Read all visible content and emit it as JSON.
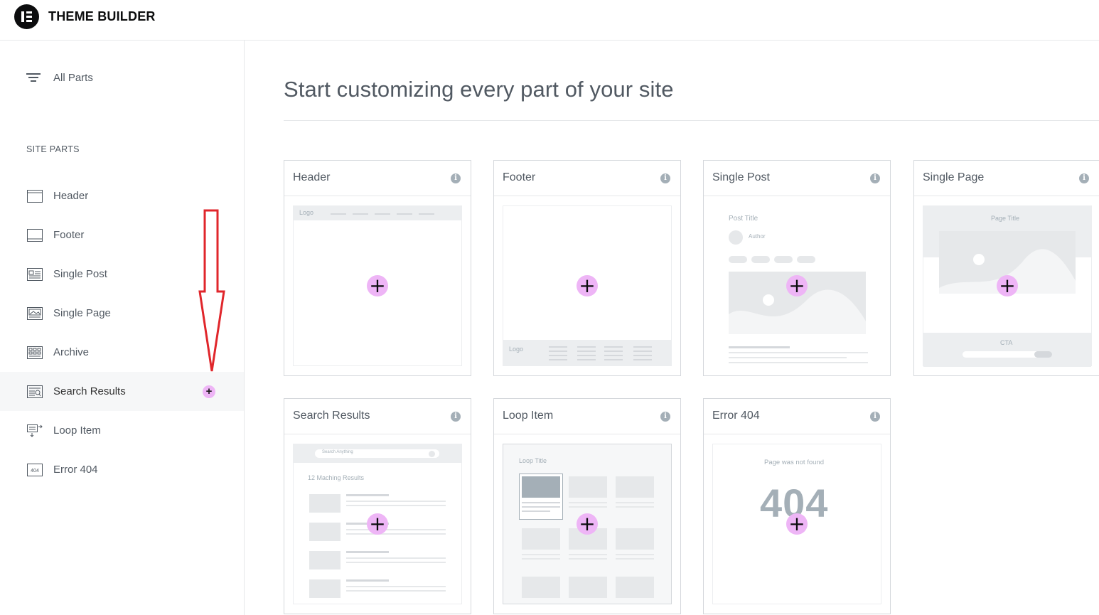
{
  "app": {
    "title": "THEME BUILDER"
  },
  "sidebar": {
    "all_parts_label": "All Parts",
    "section_label": "SITE PARTS",
    "items": [
      {
        "label": "Header",
        "icon": "header-icon"
      },
      {
        "label": "Footer",
        "icon": "footer-icon"
      },
      {
        "label": "Single Post",
        "icon": "single-post-icon"
      },
      {
        "label": "Single Page",
        "icon": "single-page-icon"
      },
      {
        "label": "Archive",
        "icon": "archive-icon"
      },
      {
        "label": "Search Results",
        "icon": "search-results-icon",
        "active": true,
        "add_symbol": "+"
      },
      {
        "label": "Loop Item",
        "icon": "loop-item-icon"
      },
      {
        "label": "Error 404",
        "icon": "error-404-icon"
      }
    ]
  },
  "main": {
    "title": "Start customizing every part of your site",
    "cards": [
      {
        "title": "Header",
        "info": "i",
        "preview": {
          "logo": "Logo"
        }
      },
      {
        "title": "Footer",
        "info": "i",
        "preview": {
          "logo": "Logo"
        }
      },
      {
        "title": "Single Post",
        "info": "i",
        "preview": {
          "post_title": "Post Title",
          "author": "Author"
        }
      },
      {
        "title": "Single Page",
        "info": "i",
        "preview": {
          "page_title": "Page Title",
          "cta": "CTA"
        }
      },
      {
        "title": "Search Results",
        "info": "i",
        "preview": {
          "search_placeholder": "Search Anything",
          "results_count": "12 Maching Results"
        }
      },
      {
        "title": "Loop Item",
        "info": "i",
        "preview": {
          "loop_title": "Loop Title"
        }
      },
      {
        "title": "Error 404",
        "info": "i",
        "preview": {
          "message": "Page was not found",
          "code": "404"
        }
      }
    ],
    "add_symbol": "+"
  },
  "colors": {
    "accent_add": "#eeb5f6",
    "annotation_arrow": "#e0262b",
    "text": "#515962",
    "border": "#d5d8dc"
  }
}
